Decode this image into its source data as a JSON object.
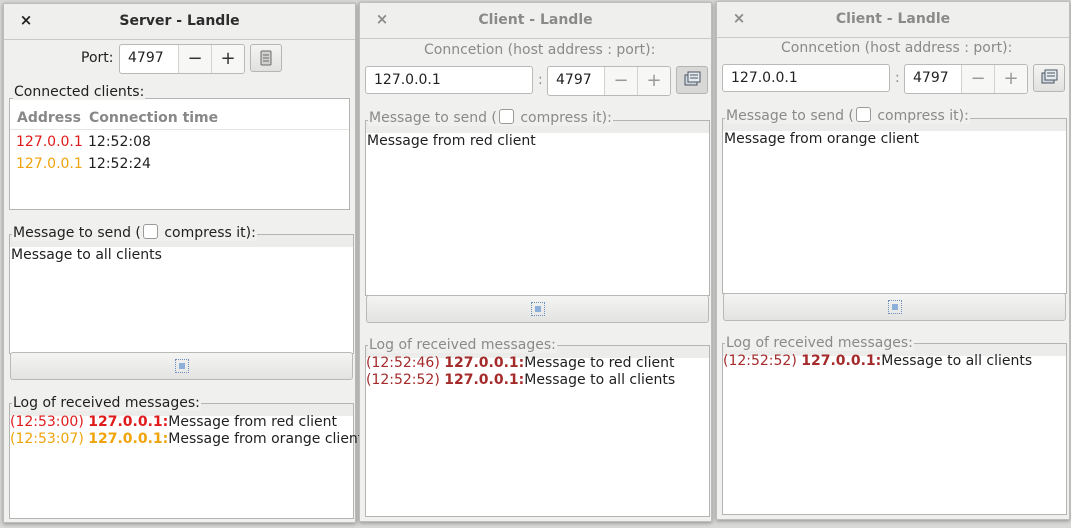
{
  "server": {
    "title": "Server - Landle",
    "close": "×",
    "port_label": "Port:",
    "port_value": "4797",
    "minus": "−",
    "plus": "+",
    "clients_label": "Connected clients:",
    "columns": [
      "Address",
      "Connection time"
    ],
    "clients": [
      {
        "address": "127.0.0.1",
        "time": "12:52:08",
        "color": "#e01b1b"
      },
      {
        "address": "127.0.0.1",
        "time": "12:52:24",
        "color": "#f0a30a"
      }
    ],
    "send_label_pre": "Message to send (",
    "send_label_post": "compress it):",
    "message": "Message to all clients",
    "log_label": "Log of received messages:",
    "log": [
      {
        "time": "(12:53:00)",
        "addr": "127.0.0.1:",
        "text": "Message from red client",
        "color": "#e01b1b"
      },
      {
        "time": "(12:53:07)",
        "addr": "127.0.0.1:",
        "text": "Message from orange client",
        "color": "#f0a30a"
      }
    ]
  },
  "client_red": {
    "title": "Client - Landle",
    "close": "×",
    "conn_label": "Conncetion (host address : port):",
    "host": "127.0.0.1",
    "colon": ":",
    "port_value": "4797",
    "minus": "−",
    "plus": "+",
    "send_label_pre": "Message to send (",
    "send_label_post": "compress it):",
    "message": "Message from red client",
    "log_label": "Log of received messages:",
    "log": [
      {
        "time": "(12:52:46)",
        "addr": "127.0.0.1:",
        "text": "Message to red client",
        "color": "#a52a2a"
      },
      {
        "time": "(12:52:52)",
        "addr": "127.0.0.1:",
        "text": "Message to all clients",
        "color": "#a52a2a"
      }
    ]
  },
  "client_orange": {
    "title": "Client - Landle",
    "close": "×",
    "conn_label": "Conncetion (host address : port):",
    "host": "127.0.0.1",
    "colon": ":",
    "port_value": "4797",
    "minus": "−",
    "plus": "+",
    "send_label_pre": "Message to send (",
    "send_label_post": "compress it):",
    "message": "Message from orange client",
    "log_label": "Log of received messages:",
    "log": [
      {
        "time": "(12:52:52)",
        "addr": "127.0.0.1:",
        "text": "Message to all clients",
        "color": "#a52a2a"
      }
    ]
  }
}
